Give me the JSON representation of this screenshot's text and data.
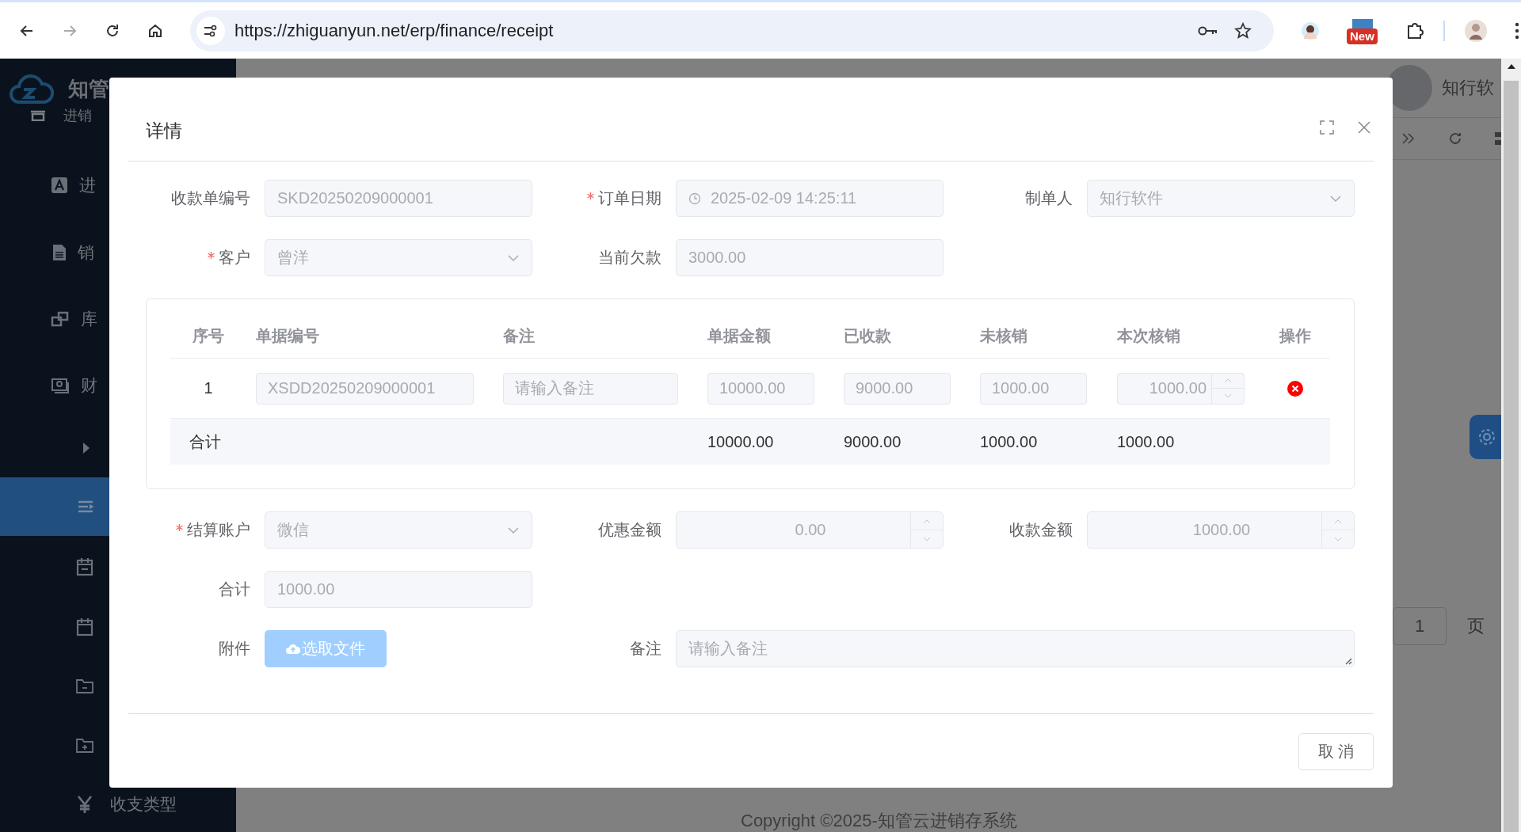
{
  "browser": {
    "url": "https://zhiguanyun.net/erp/finance/receipt",
    "badge": "New"
  },
  "sidebar": {
    "logo": "知管",
    "section": "进销",
    "items": [
      {
        "label": "进",
        "selected": false
      },
      {
        "label": "销",
        "selected": false
      },
      {
        "label": "库",
        "selected": false
      },
      {
        "label": "财",
        "selected": false
      },
      {
        "selected": false
      },
      {
        "selected": true
      },
      {
        "selected": false
      },
      {
        "selected": false
      },
      {
        "selected": false
      },
      {
        "selected": false
      },
      {
        "label": "收支类型",
        "selected": false
      }
    ]
  },
  "header": {
    "user": "知行软"
  },
  "pager": {
    "page": "1",
    "unit": "页"
  },
  "footer": {
    "copyright": "Copyright ©2025-知管云进销存系统"
  },
  "dialog": {
    "title": "详情",
    "top_rows": [
      [
        {
          "label": "收款单编号",
          "required": false,
          "kind": "text",
          "value": "SKD20250209000001",
          "disabled": true
        },
        {
          "label": "订单日期",
          "required": true,
          "kind": "date",
          "value": "2025-02-09 14:25:11",
          "disabled": true
        },
        {
          "label": "制单人",
          "required": false,
          "kind": "select",
          "value": "知行软件",
          "disabled": true
        }
      ],
      [
        {
          "label": "客户",
          "required": true,
          "kind": "select",
          "value": "曾洋",
          "disabled": true
        },
        {
          "label": "当前欠款",
          "required": false,
          "kind": "text",
          "value": "3000.00",
          "disabled": true
        }
      ]
    ],
    "table": {
      "columns": [
        "序号",
        "单据编号",
        "备注",
        "单据金额",
        "已收款",
        "未核销",
        "本次核销",
        "操作"
      ],
      "rows": [
        {
          "cells": [
            {
              "kind": "plain",
              "value": "1"
            },
            {
              "kind": "text",
              "value": "XSDD20250209000001"
            },
            {
              "kind": "text",
              "placeholder": "请输入备注"
            },
            {
              "kind": "text",
              "value": "10000.00"
            },
            {
              "kind": "text",
              "value": "9000.00"
            },
            {
              "kind": "text",
              "value": "1000.00"
            },
            {
              "kind": "number",
              "value": "1000.00"
            }
          ]
        }
      ],
      "total": {
        "label": "合计",
        "values": [
          "10000.00",
          "9000.00",
          "1000.00",
          "1000.00"
        ]
      }
    },
    "bottom_rows": [
      [
        {
          "label": "结算账户",
          "required": true,
          "kind": "select",
          "value": "微信",
          "disabled": true
        },
        {
          "label": "优惠金额",
          "required": false,
          "kind": "number",
          "value": "0.00",
          "disabled": true
        },
        {
          "label": "收款金额",
          "required": false,
          "kind": "number",
          "value": "1000.00",
          "disabled": true
        }
      ],
      [
        {
          "label": "合计",
          "required": false,
          "kind": "text",
          "value": "1000.00",
          "disabled": true
        }
      ],
      [
        {
          "label": "附件",
          "required": false,
          "kind": "upload",
          "button": "选取文件",
          "disabled": true
        },
        {
          "label": "备注",
          "required": false,
          "kind": "textarea",
          "placeholder": "请输入备注"
        }
      ]
    ],
    "buttons": [
      "取 消"
    ]
  }
}
